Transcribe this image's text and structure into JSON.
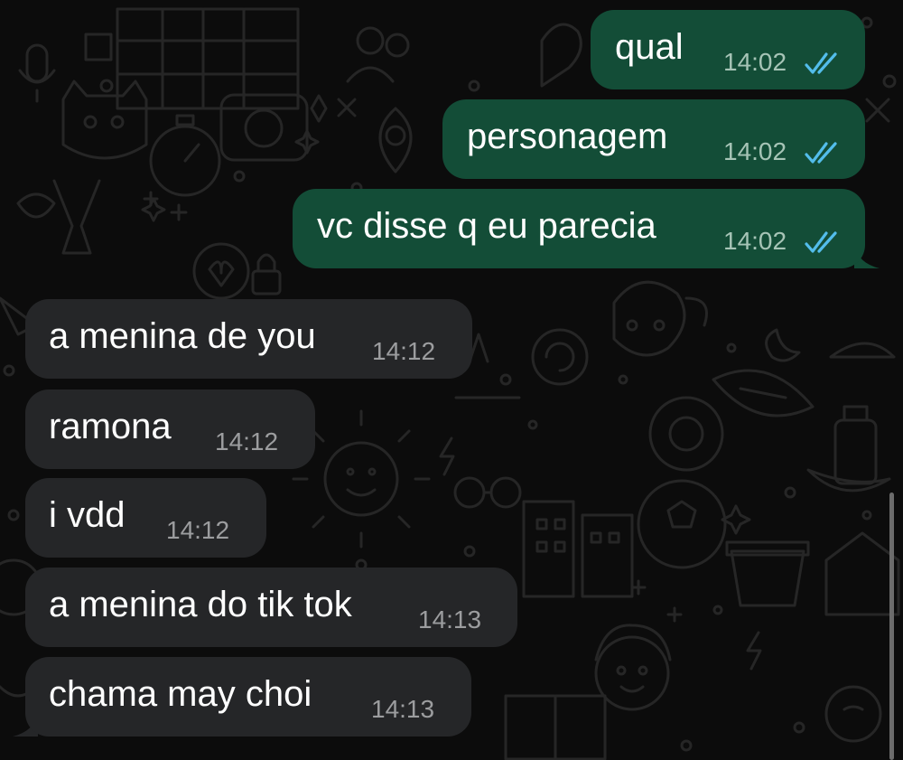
{
  "conversation": {
    "messages": [
      {
        "direction": "outgoing",
        "text": "qual",
        "time": "14:02",
        "status": "read"
      },
      {
        "direction": "outgoing",
        "text": "personagem",
        "time": "14:02",
        "status": "read"
      },
      {
        "direction": "outgoing",
        "text": "vc disse q eu parecia",
        "time": "14:02",
        "status": "read"
      },
      {
        "direction": "incoming",
        "text": "a menina de you",
        "time": "14:12"
      },
      {
        "direction": "incoming",
        "text": "ramona",
        "time": "14:12"
      },
      {
        "direction": "incoming",
        "text": "i vdd",
        "time": "14:12"
      },
      {
        "direction": "incoming",
        "text": "a menina do tik tok",
        "time": "14:13"
      },
      {
        "direction": "incoming",
        "text": "chama may choi",
        "time": "14:13"
      }
    ]
  },
  "theme": {
    "outgoing_bubble": "#134d37",
    "incoming_bubble": "#252628",
    "read_ticks": "#53bdeb",
    "background": "#0c0c0c",
    "wallpaper_doodles": "#262626"
  },
  "icons": {
    "read_receipt": "double-check-icon"
  }
}
